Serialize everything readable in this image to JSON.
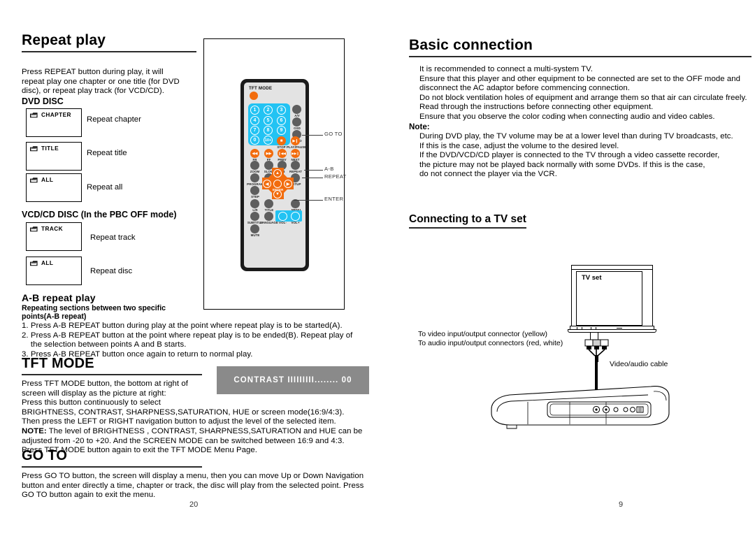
{
  "left_page": {
    "page_number": "20",
    "repeat_play": {
      "title": "Repeat play",
      "intro": [
        "Press REPEAT button during play, it will",
        "repeat play one chapter or one title (for DVD",
        "disc), or repeat play track (for VCD/CD)."
      ],
      "dvd_heading": "DVD DISC",
      "dvd_items": [
        {
          "icon": "repeat-folder-icon",
          "badge": "CHAPTER",
          "desc": "Repeat chapter"
        },
        {
          "icon": "repeat-folder-icon",
          "badge": "TITLE",
          "desc": "Repeat title"
        },
        {
          "icon": "repeat-folder-icon",
          "badge": "ALL",
          "desc": "Repeat all"
        }
      ],
      "vcd_heading": "VCD/CD DISC (In the PBC OFF mode)",
      "vcd_items": [
        {
          "icon": "repeat-folder-icon",
          "badge": "TRACK",
          "desc": "Repeat track"
        },
        {
          "icon": "repeat-folder-icon",
          "badge": "ALL",
          "desc": "Repeat disc"
        }
      ],
      "ab": {
        "title": "A-B repeat play",
        "subtitle_line1": "Repeating sections between two specific",
        "subtitle_line2": "points(A-B repeat)",
        "steps": [
          "1. Press A-B REPEAT button during play at the point where repeat play is to be started(A).",
          "2. Press A-B REPEAT button at the point where repeat play is to be ended(B). Repeat play of",
          "    the selection between points A and B starts.",
          "3. Press A-B REPEAT button once again to return to normal play."
        ]
      }
    },
    "tft_mode": {
      "title": "TFT MODE",
      "osd_text": "CONTRAST IIIIIIIII........ 00",
      "lines": [
        "Press TFT MODE button, the bottom at right of",
        "screen will display as the picture at right:",
        "Press this button continuously to select",
        "BRIGHTNESS, CONTRAST, SHARPNESS,SATURATION, HUE or  screen mode(16:9/4:3).",
        "Then press the LEFT or RIGHT navigation button to adjust the level of the selected item."
      ],
      "note_label": "NOTE:",
      "note_lines": [
        " The level of BRIGHTNESS , CONTRAST, SHARPNESS,SATURATION and HUE can be",
        "adjusted from -20 to +20. And  the SCREEN MODE can be switched between 16:9 and 4:3.",
        "Press TFT MODE button again to exit the TFT MODE Menu Page."
      ]
    },
    "go_to": {
      "title": "GO TO",
      "lines": [
        "Press GO TO button,  the screen will display a menu, then you can move Up or Down Navigation",
        "button and enter directly a time, chapter or track, the disc will play from the selected point. Press",
        "GO TO button again to exit the menu."
      ]
    }
  },
  "remote": {
    "tft_mode_label": "TFT MODE",
    "numbers": [
      "1",
      "2",
      "3",
      "4",
      "5",
      "6",
      "7",
      "8",
      "9",
      "0",
      "10+"
    ],
    "side_buttons": [
      {
        "tag": "A/V"
      },
      {
        "tag": "OSD"
      },
      {
        "tag": "GOTO"
      }
    ],
    "transport": [
      {
        "tag": "STOP",
        "glyph": "■"
      },
      {
        "tag": "PLAY/PAUSE",
        "glyph": "▶❙"
      },
      {
        "tag": "FR",
        "glyph": "◀◀"
      },
      {
        "tag": "FF",
        "glyph": "▶▶"
      },
      {
        "tag": "PREV",
        "glyph": "❙◀◀"
      },
      {
        "tag": "NEXT",
        "glyph": "▶▶❙"
      }
    ],
    "function_buttons": [
      "ZOOM",
      "SLOW",
      "A-B",
      "REPEAT",
      "PROGRAM",
      "ANGLE",
      "SETUP",
      "STEP",
      "L/R",
      "TITLE",
      "MENU",
      "SUBTITLE",
      "LANGUAGE",
      "VOL-",
      "VOL+",
      "MUTE"
    ],
    "dpad_center": "ENTER",
    "callouts": [
      "GO TO",
      "A-B",
      "REPEAT",
      "ENTER"
    ]
  },
  "right_page": {
    "page_number": "9",
    "basic_connection": {
      "title": "Basic connection",
      "lines": [
        "It is recommended to connect a multi-system TV.",
        "Ensure that this player and other equipment to be connected are set to the OFF mode and",
        "disconnect the AC adaptor before commencing connection.",
        "Do not block ventilation holes of equipment and arrange them so that air can circulate freely.",
        "Read through the instructions before connecting other equipment.",
        "Ensure that you observe the color coding when connecting audio and video cables."
      ],
      "note_label": "Note:",
      "note_lines": [
        "During DVD play, the TV volume may be at a lower level than during TV broadcasts, etc.",
        "If this is the case, adjust the volume to the desired level.",
        "If the DVD/VCD/CD player is connected to the TV through a video cassette recorder,",
        "the picture may not be played back normally with some DVDs. If this is the case,",
        "do not connect the player via the VCR."
      ]
    },
    "connecting": {
      "title": "Connecting to a TV set",
      "tv_label": "TV set",
      "video_note": "To video input/output connector (yellow)",
      "audio_note": "To audio  input/output connectors (red, white)",
      "cable_label": "Video/audio cable"
    }
  },
  "colors": {
    "orange": "#f26c0d",
    "cyan": "#22c3f3",
    "dark_button": "#5e5e5e",
    "remote_body": "#1b1b1b",
    "remote_face": "#e3e3e3",
    "osd_bg": "#8a8a8a",
    "rule": "#2b2b2b"
  }
}
